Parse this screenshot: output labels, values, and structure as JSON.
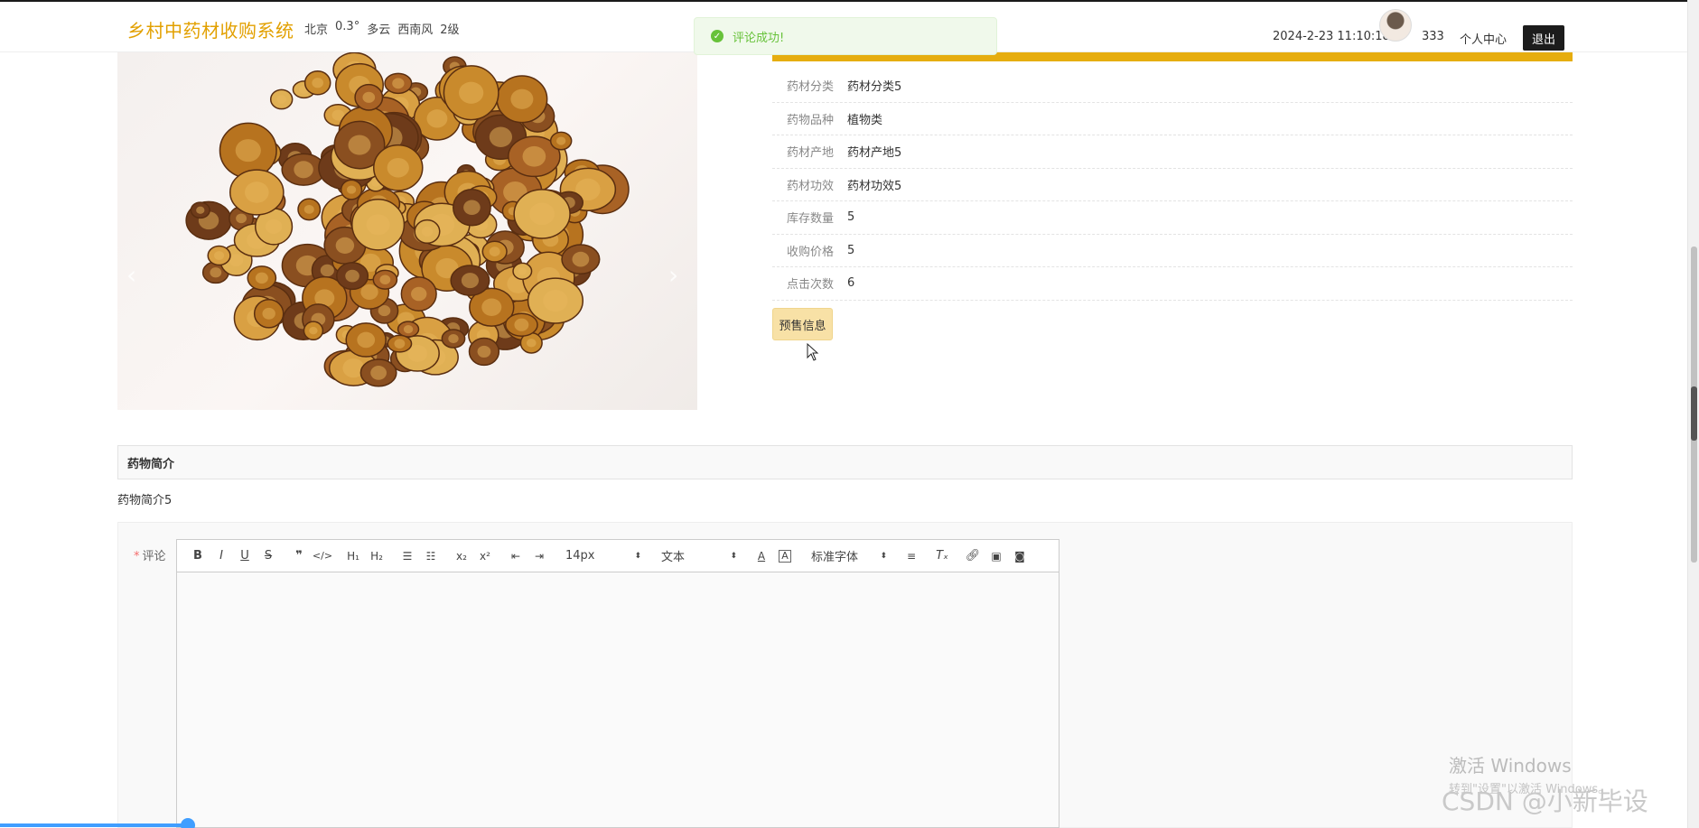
{
  "header": {
    "brand": "乡村中药材收购系统",
    "weather": [
      "北京",
      "0.3°",
      "多云",
      "西南风",
      "2级"
    ],
    "datetime": "2024-2-23 11:10:18",
    "username": "333",
    "personal_center": "个人中心",
    "logout": "退出"
  },
  "toast": {
    "message": "评论成功!",
    "icon": "check-circle-icon",
    "color": "#67c23a"
  },
  "details": {
    "rows": [
      {
        "label": "药材分类",
        "value": "药材分类5"
      },
      {
        "label": "药物品种",
        "value": "植物类"
      },
      {
        "label": "药材产地",
        "value": "药材产地5"
      },
      {
        "label": "药材功效",
        "value": "药材功效5"
      },
      {
        "label": "库存数量",
        "value": "5"
      },
      {
        "label": "收购价格",
        "value": "5"
      },
      {
        "label": "点击次数",
        "value": "6"
      }
    ],
    "presale_button": "预售信息",
    "accent_color": "#e6ad0f"
  },
  "intro": {
    "heading": "药物简介",
    "body": "药物简介5"
  },
  "comment": {
    "label": "评论",
    "required_mark": "*",
    "toolbar": {
      "font_size": "14px",
      "block_type": "文本",
      "font_family": "标准字体"
    }
  },
  "watermarks": {
    "windows_title": "激活 Windows",
    "windows_sub": "转到\"设置\"以激活 Windows。",
    "csdn": "CSDN @小新毕设"
  }
}
